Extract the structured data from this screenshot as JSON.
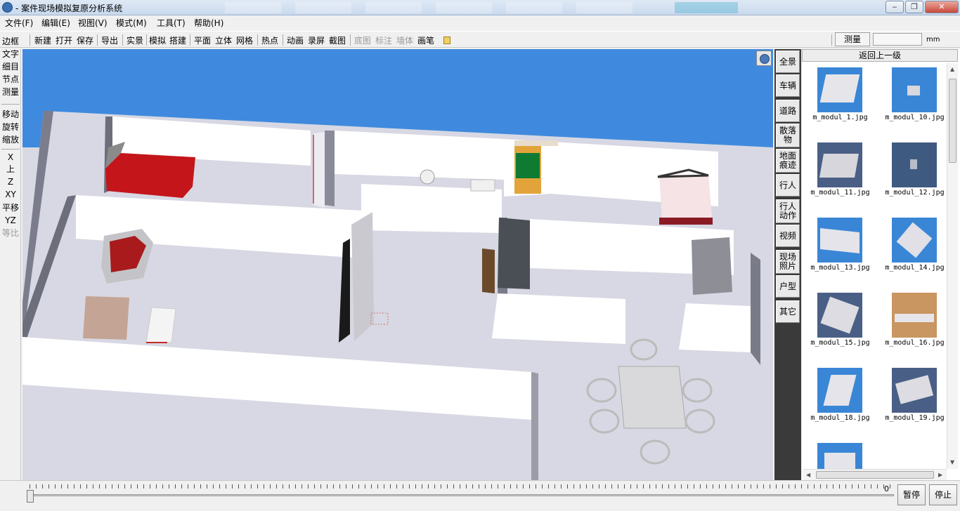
{
  "window": {
    "title": "- 案件现场模拟复原分析系统",
    "controls": [
      "minimize-icon",
      "maximize-icon",
      "close-icon"
    ]
  },
  "menu": {
    "items": [
      "文件(F)",
      "编辑(E)",
      "视图(V)",
      "模式(M)",
      "工具(T)",
      "帮助(H)"
    ]
  },
  "toolbar": {
    "buttons": [
      {
        "label": "新建",
        "enabled": true
      },
      {
        "label": "打开",
        "enabled": true
      },
      {
        "label": "保存",
        "enabled": true
      },
      {
        "label": "导出",
        "enabled": true
      },
      {
        "label": "实景",
        "enabled": true
      },
      {
        "label": "模拟",
        "enabled": true
      },
      {
        "label": "搭建",
        "enabled": true
      },
      {
        "label": "平面",
        "enabled": true
      },
      {
        "label": "立体",
        "enabled": true
      },
      {
        "label": "网格",
        "enabled": true
      },
      {
        "label": "热点",
        "enabled": true
      },
      {
        "label": "动画",
        "enabled": true
      },
      {
        "label": "录屏",
        "enabled": true
      },
      {
        "label": "截图",
        "enabled": true
      },
      {
        "label": "底图",
        "enabled": false
      },
      {
        "label": "标注",
        "enabled": false
      },
      {
        "label": "墙体",
        "enabled": false
      },
      {
        "label": "画笔",
        "enabled": true
      }
    ],
    "measure": {
      "label": "测量",
      "value": "",
      "unit": "mm"
    }
  },
  "left_tools": [
    {
      "label": "边框",
      "enabled": true
    },
    {
      "label": "文字",
      "enabled": true
    },
    {
      "label": "细目",
      "enabled": true
    },
    {
      "label": "节点",
      "enabled": true
    },
    {
      "label": "测量",
      "enabled": true
    },
    {
      "label": "移动",
      "enabled": true
    },
    {
      "label": "旋转",
      "enabled": true
    },
    {
      "label": "缩放",
      "enabled": true
    },
    {
      "label": "X",
      "enabled": true
    },
    {
      "label": "上",
      "enabled": true
    },
    {
      "label": "Z",
      "enabled": true
    },
    {
      "label": "XY",
      "enabled": true
    },
    {
      "label": "平移",
      "enabled": true
    },
    {
      "label": "YZ",
      "enabled": true
    },
    {
      "label": "等比",
      "enabled": false
    }
  ],
  "categories": [
    "全景",
    "车辆",
    "道路",
    "散落物",
    "地面痕迹",
    "行人",
    "行人动作",
    "视频",
    "现场照片",
    "户型",
    "其它"
  ],
  "library": {
    "back_label": "返回上一级",
    "items": [
      {
        "caption": "m_modul_1.jpg",
        "color": "#3a86d6"
      },
      {
        "caption": "m_modul_10.jpg",
        "color": "#3a86d6"
      },
      {
        "caption": "m_modul_11.jpg",
        "color": "#4a5f85"
      },
      {
        "caption": "m_modul_12.jpg",
        "color": "#3f5a80"
      },
      {
        "caption": "m_modul_13.jpg",
        "color": "#3a86d6"
      },
      {
        "caption": "m_modul_14.jpg",
        "color": "#3a86d6"
      },
      {
        "caption": "m_modul_15.jpg",
        "color": "#4a5f85"
      },
      {
        "caption": "m_modul_16.jpg",
        "color": "#c99560"
      },
      {
        "caption": "m_modul_18.jpg",
        "color": "#3a86d6"
      },
      {
        "caption": "m_modul_19.jpg",
        "color": "#4a5f85"
      },
      {
        "caption": "",
        "color": "#3a86d6"
      }
    ]
  },
  "timeline": {
    "frame": "0",
    "pause_label": "暂停",
    "stop_label": "停止"
  }
}
